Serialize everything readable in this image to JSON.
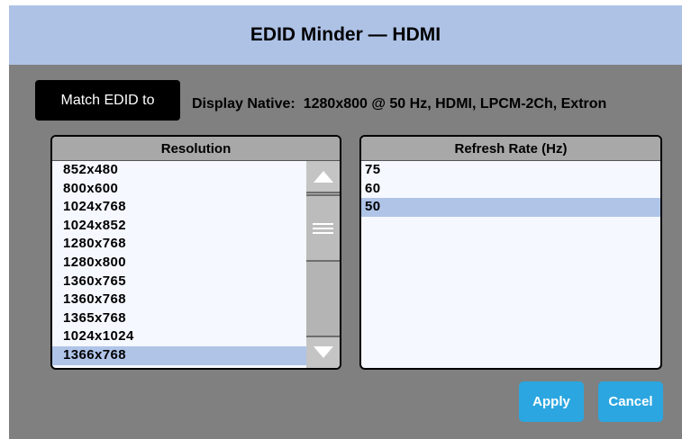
{
  "window": {
    "title": "EDID Minder — HDMI"
  },
  "match": {
    "button_label": "Match EDID to",
    "native_label": "Display Native:",
    "native_value": "1280x800 @ 50 Hz, HDMI, LPCM-2Ch, Extron"
  },
  "resolution": {
    "header": "Resolution",
    "items": [
      "852x480",
      "800x600",
      "1024x768",
      "1024x852",
      "1280x768",
      "1280x800",
      "1360x765",
      "1360x768",
      "1365x768",
      "1024x1024",
      "1366x768"
    ],
    "selected": "1366x768"
  },
  "refresh_rate": {
    "header": "Refresh Rate (Hz)",
    "items": [
      "75",
      "60",
      "50"
    ],
    "selected": "50"
  },
  "buttons": {
    "apply": "Apply",
    "cancel": "Cancel"
  },
  "colors": {
    "titlebar": "#aec2e6",
    "background": "#808080",
    "selection": "#b0c4e8",
    "button": "#2ba6e0"
  },
  "icons": {
    "scroll_up": "triangle-up-icon",
    "scroll_down": "triangle-down-icon",
    "scroll_grip": "grip-lines-icon"
  }
}
